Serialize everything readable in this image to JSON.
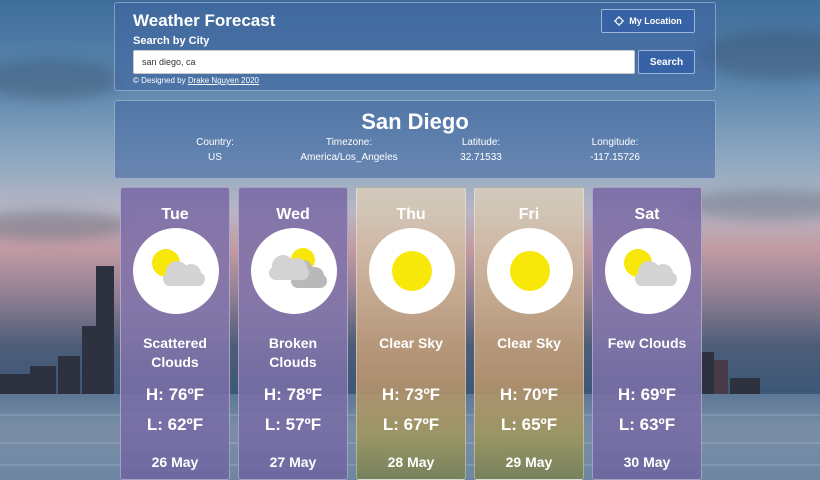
{
  "header": {
    "title": "Weather Forecast",
    "search_label": "Search by City",
    "search_value": "san diego, ca",
    "search_button": "Search",
    "location_button": "My Location",
    "credit_prefix": "© Designed by ",
    "credit_link": "Drake Nguyen 2020"
  },
  "city": {
    "name": "San Diego",
    "country_label": "Country:",
    "country_value": "US",
    "timezone_label": "Timezone:",
    "timezone_value": "America/Los_Angeles",
    "latitude_label": "Latitude:",
    "latitude_value": "32.71533",
    "longitude_label": "Longitude:",
    "longitude_value": "-117.15726"
  },
  "forecast": [
    {
      "day": "Tue",
      "icon": "sun-cloud-icon",
      "desc_line1": "Scattered",
      "desc_line2": "Clouds",
      "high": "H: 76ºF",
      "low": "L: 62ºF",
      "date": "26 May"
    },
    {
      "day": "Wed",
      "icon": "cloud-sun-icon",
      "desc_line1": "Broken",
      "desc_line2": "Clouds",
      "high": "H: 78ºF",
      "low": "L: 57ºF",
      "date": "27 May"
    },
    {
      "day": "Thu",
      "icon": "sun-icon",
      "desc_line1": "Clear Sky",
      "desc_line2": "",
      "high": "H: 73ºF",
      "low": "L: 67ºF",
      "date": "28 May"
    },
    {
      "day": "Fri",
      "icon": "sun-icon",
      "desc_line1": "Clear Sky",
      "desc_line2": "",
      "high": "H: 70ºF",
      "low": "L: 65ºF",
      "date": "29 May"
    },
    {
      "day": "Sat",
      "icon": "sun-cloud-icon",
      "desc_line1": "Few Clouds",
      "desc_line2": "",
      "high": "H: 69ºF",
      "low": "L: 63ºF",
      "date": "30 May"
    }
  ],
  "colors": {
    "button": "#3762a6",
    "sun": "#f7e80a",
    "cloud": "#d3d3d3"
  }
}
